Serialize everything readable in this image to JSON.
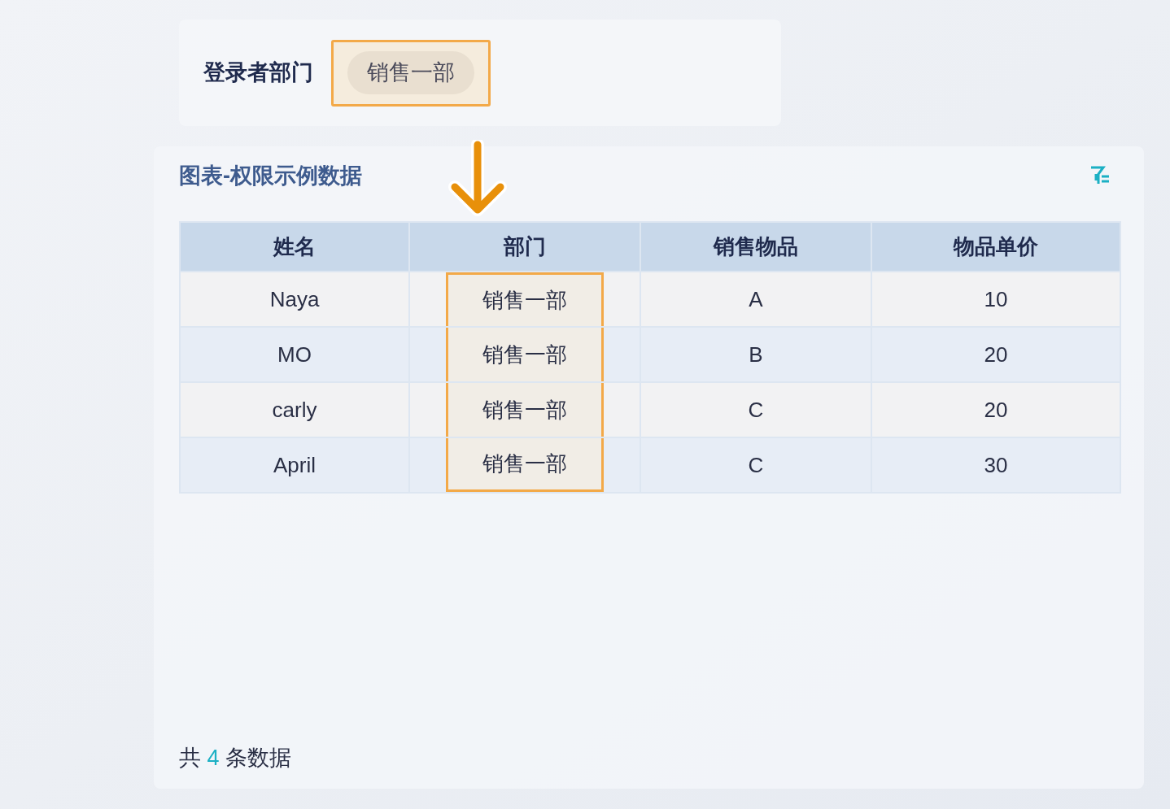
{
  "login_department": {
    "label": "登录者部门",
    "value": "销售一部",
    "highlighted": true
  },
  "panel": {
    "title": "图表-权限示例数据",
    "table": {
      "columns": [
        {
          "label": "姓名",
          "highlighted": false
        },
        {
          "label": "部门",
          "highlighted": true
        },
        {
          "label": "销售物品",
          "highlighted": false
        },
        {
          "label": "物品单价",
          "highlighted": false
        }
      ],
      "rows": [
        [
          "Naya",
          "销售一部",
          "A",
          "10"
        ],
        [
          "MO",
          "销售一部",
          "B",
          "20"
        ],
        [
          "carly",
          "销售一部",
          "C",
          "20"
        ],
        [
          "April",
          "销售一部",
          "C",
          "30"
        ]
      ]
    },
    "footer": {
      "prefix": "共",
      "count": "4",
      "suffix": "条数据"
    }
  }
}
